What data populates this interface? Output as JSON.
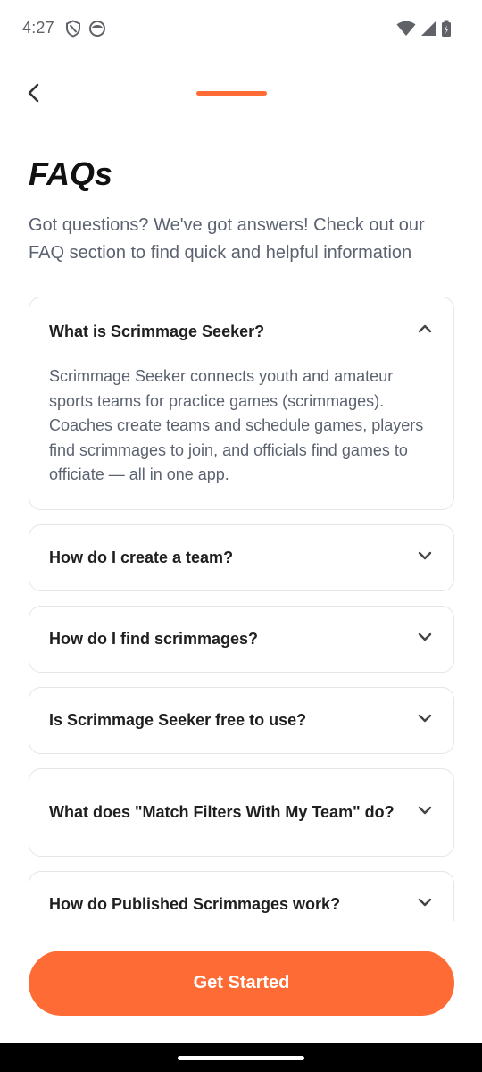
{
  "status_bar": {
    "time": "4:27",
    "left_icons": [
      "shield-icon",
      "face-icon"
    ],
    "right_icons": [
      "wifi-icon",
      "signal-icon",
      "battery-icon"
    ]
  },
  "header": {
    "back_icon": "chevron-left-icon",
    "progress": 1.0,
    "accent_color": "#ff6b35"
  },
  "page": {
    "title": "FAQs",
    "subtitle": "Got questions? We've got answers! Check out our FAQ section to find quick and helpful information"
  },
  "faqs": [
    {
      "question": "What is Scrimmage Seeker?",
      "answer": "Scrimmage Seeker connects youth and amateur sports teams for practice games (scrimmages). Coaches create teams and schedule games, players find scrimmages to join, and officials find games to officiate — all in one app.",
      "expanded": true
    },
    {
      "question": "How do I create a team?",
      "expanded": false
    },
    {
      "question": "How do I find scrimmages?",
      "expanded": false
    },
    {
      "question": "Is Scrimmage Seeker free to use?",
      "expanded": false
    },
    {
      "question": "What does \"Match Filters With My Team\" do?",
      "expanded": false
    },
    {
      "question": "How do Published Scrimmages work?",
      "expanded": false
    }
  ],
  "cta": {
    "label": "Get Started"
  }
}
